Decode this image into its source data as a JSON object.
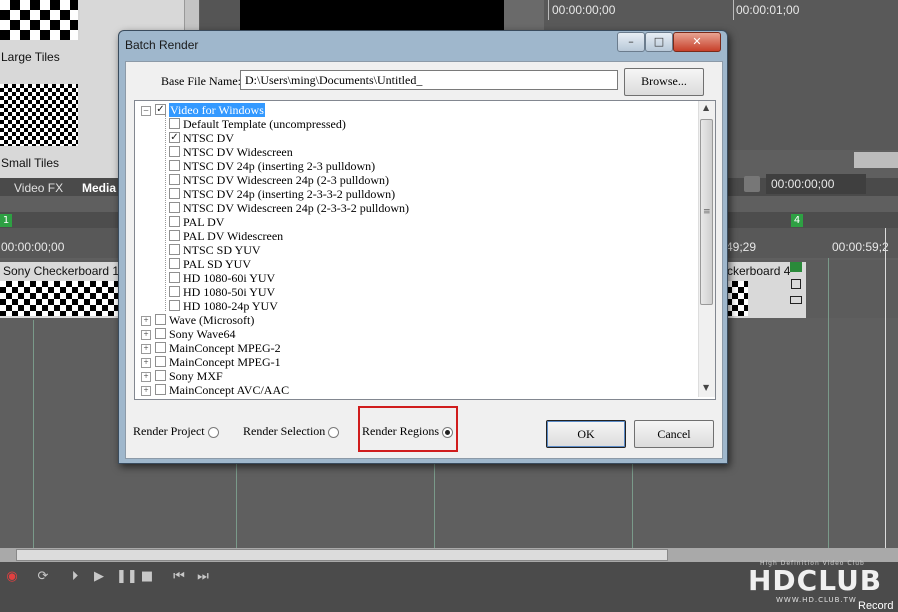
{
  "background": {
    "media_tiles": {
      "large_label": "Large Tiles",
      "small_label": "Small Tiles"
    },
    "tabs": {
      "video_fx": "Video FX",
      "media": "Media"
    },
    "preview_timecode": "00:00:00;00",
    "top_ruler": {
      "t0": "00:00:00;00",
      "t1": "00:00:01;00"
    },
    "markers": {
      "left": "1",
      "right": "4"
    },
    "timeline_ruler": {
      "left": "00:00:00;00",
      "mid": "49;29",
      "right": "00:00:59;2"
    },
    "events": {
      "left_clip": "Sony Checkerboard 1",
      "right_clip": "ckerboard 4"
    },
    "watermark": {
      "logo": "HDCLUB",
      "tagline": "High Definition Video Club",
      "url": "WWW.HD.CLUB.TW",
      "record": "Record"
    }
  },
  "dialog": {
    "title": "Batch Render",
    "caption_buttons": {
      "minimize": "–",
      "maximize": "□",
      "close": "✕"
    },
    "base_file_label": "Base File Name:",
    "base_file_value": "D:\\Users\\ming\\Documents\\Untitled_",
    "browse_label": "Browse...",
    "tree": {
      "root": {
        "label": "Video for Windows",
        "checked": true,
        "expanded": true
      },
      "children": [
        {
          "label": "Default Template (uncompressed)",
          "checked": false
        },
        {
          "label": "NTSC DV",
          "checked": true
        },
        {
          "label": "NTSC DV Widescreen",
          "checked": false
        },
        {
          "label": "NTSC DV 24p (inserting 2-3 pulldown)",
          "checked": false
        },
        {
          "label": "NTSC DV Widescreen 24p (2-3 pulldown)",
          "checked": false
        },
        {
          "label": "NTSC DV 24p (inserting 2-3-3-2 pulldown)",
          "checked": false
        },
        {
          "label": "NTSC DV Widescreen 24p (2-3-3-2 pulldown)",
          "checked": false
        },
        {
          "label": "PAL DV",
          "checked": false
        },
        {
          "label": "PAL DV Widescreen",
          "checked": false
        },
        {
          "label": "NTSC SD YUV",
          "checked": false
        },
        {
          "label": "PAL SD YUV",
          "checked": false
        },
        {
          "label": "HD 1080-60i YUV",
          "checked": false
        },
        {
          "label": "HD 1080-50i YUV",
          "checked": false
        },
        {
          "label": "HD 1080-24p YUV",
          "checked": false
        }
      ],
      "groups": [
        {
          "label": "Wave (Microsoft)"
        },
        {
          "label": "Sony Wave64"
        },
        {
          "label": "MainConcept MPEG-2"
        },
        {
          "label": "MainConcept MPEG-1"
        },
        {
          "label": "Sony MXF"
        },
        {
          "label": "MainConcept AVC/AAC"
        }
      ]
    },
    "render_options": {
      "project": "Render Project",
      "selection": "Render Selection",
      "regions": "Render Regions",
      "selected": "regions"
    },
    "ok_label": "OK",
    "cancel_label": "Cancel",
    "highlight_color": "#d01c1c",
    "selection_color": "#3399ff"
  }
}
